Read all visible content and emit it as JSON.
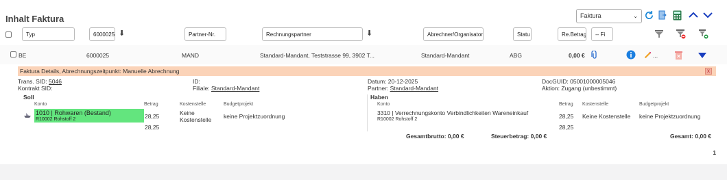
{
  "title": "Inhalt Faktura",
  "toolbar": {
    "select_value": "Faktura",
    "icons": [
      "refresh-icon",
      "export-icon",
      "calculator-icon",
      "chevron-up-icon",
      "chevron-down-icon"
    ],
    "accent": "#1b6fd1"
  },
  "filters": {
    "typ": "Typ",
    "number": "6000025",
    "partner_nr": "Partner-Nr.",
    "rechnungspartner": "Rechnungspartner",
    "abrechner": "Abrechner/Organisator",
    "status": "Statu",
    "re_betrag": "Re.Betrag",
    "dropdown": "-- Fi"
  },
  "row": {
    "typ": "BE",
    "number": "6000025",
    "partner_nr": "MAND",
    "rechnungspartner": "Standard-Mandant, Teststrasse 99, 3902 T...",
    "abrechner": "Standard-Mandant",
    "status": "ABG",
    "betrag": "0,00 €",
    "more": "..."
  },
  "details": {
    "header": "Faktura Details, Abrechnungszeitpunkt: Manuelle Abrechnung",
    "close": "x",
    "trans_sid_label": "Trans. SID:",
    "trans_sid": "5046",
    "kontrakt_sid_label": "Kontrakt SID:",
    "id_label": "ID:",
    "filiale_label": "Filiale:",
    "filiale": "Standard-Mandant",
    "datum_label": "Datum:",
    "datum": "20-12-2025",
    "partner_label": "Partner:",
    "partner": "Standard-Mandant",
    "docguid_label": "DocGUID:",
    "docguid": "05001000005046",
    "aktion_label": "Aktion:",
    "aktion": "Zugang (unbestimmt)"
  },
  "soll": {
    "title": "Soll",
    "headers": {
      "konto": "Konto",
      "betrag": "Betrag",
      "kostenstelle": "Kostenstelle",
      "budget": "Budgetprojekt"
    },
    "konto": "1010 | Rohwaren (Bestand)",
    "konto_sub": "R10002 Rohstoff 2",
    "betrag1": "28,25",
    "betrag2": "28,25",
    "kostenstelle_line1": "Keine",
    "kostenstelle_line2": "Kostenstelle",
    "budget": "keine Projektzuordnung"
  },
  "haben": {
    "title": "Haben",
    "headers": {
      "konto": "Konto",
      "betrag": "Betrag",
      "kostenstelle": "Kostenstelle",
      "budget": "Budgetprojekt"
    },
    "konto": "3310 | Verrechnungskonto Verbindlichkeiten Wareneinkauf",
    "konto_sub": "R10002 Rohstoff 2",
    "betrag1": "28,25",
    "betrag2": "28,25",
    "kostenstelle": "Keine Kostenstelle",
    "budget": "keine Projektzuordnung"
  },
  "totals": {
    "brutto": "Gesamtbrutto: 0,00 €",
    "steuer": "Steuerbetrag: 0,00 €",
    "gesamt": "Gesamt: 0,00 €"
  },
  "pagination": {
    "page": "1"
  }
}
